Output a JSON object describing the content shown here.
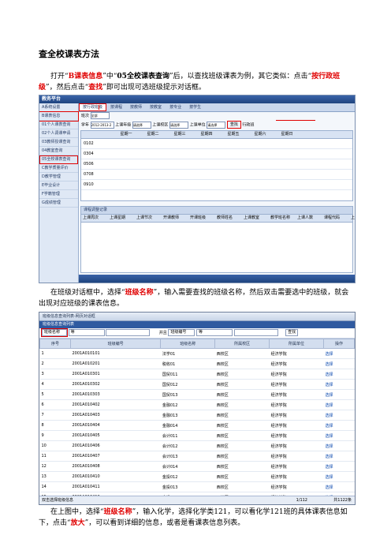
{
  "title": "查全校课表方法",
  "para1": {
    "t1": "打开“",
    "r1": "B课表信息",
    "t2": "”中“",
    "b1": "05全校课表查询",
    "t3": "”后，以查找班级课表为例，其它类似：点击“",
    "r2": "按行政班级",
    "t4": "”，然后点击“",
    "r3": "查找",
    "t5": "”即可出现可选班级提示对话框。"
  },
  "shot1": {
    "top_title": "教务平台",
    "side_items": [
      "A系统设置",
      "B课表信息",
      "01个人课表查询",
      "02个人调课申请",
      "03教师授课查询",
      "04教室查询",
      "05全校课表查询",
      "C教学质量评价",
      "D教学管理",
      "E毕业设计",
      "F学籍管理",
      "G成绩管理"
    ],
    "tabs": [
      "按行政班级",
      "按课程",
      "按教师",
      "按教室",
      "按专业",
      "按学生"
    ],
    "row1": "班次",
    "row1_sel": "全部",
    "row2": "学年",
    "row2_val": "2012-2013-2",
    "row2_f1": "上课年级",
    "row2_f2": "上课校区",
    "row2_f3": "上课单位",
    "select_ph": "请选择",
    "find_btn": "查找",
    "class_label": "行政班",
    "grid_headers": [
      "星期一",
      "星期二",
      "星期三",
      "星期四",
      "星期五",
      "星期六",
      "星期日"
    ],
    "grid_rows": [
      "0102",
      "0304",
      "0506",
      "0708",
      "0910"
    ],
    "lower_title": "课程调整记录",
    "lower_headers": [
      "上课周次",
      "上课星期",
      "上课节次",
      "开课教师",
      "开课班级",
      "教师姓名",
      "上课教室",
      "教学班名称",
      "上课人数",
      "课程代码",
      "上课周",
      "备注"
    ]
  },
  "para2": {
    "t1": "在班级对话框中，选择“",
    "r1": "班级名称",
    "t2": "”，输入需要查找的班级名称，然后双击需要选中的班级，就会出现对应班级的课表信息。"
  },
  "shot2": {
    "title": "班级信息查询列表-网页对话框",
    "sub": "班级信息查询列表",
    "f1_val": "班级名称",
    "op1": "等",
    "and_label": "并且",
    "f2_val": "班级编号",
    "op2": "等",
    "find_btn": "查找",
    "headers": [
      "序号",
      "班级编号",
      "班级名称",
      "所属校区",
      "所属单位",
      "操作"
    ],
    "rows": [
      [
        "1",
        "2001A010101",
        "法学01",
        "西校区",
        "经济学院",
        "选择"
      ],
      [
        "2",
        "2001A010201",
        "税收01",
        "西校区",
        "经济学院",
        "选择"
      ],
      [
        "3",
        "2001A010301",
        "国贸011",
        "西校区",
        "经济学院",
        "选择"
      ],
      [
        "4",
        "2001A010302",
        "国贸012",
        "西校区",
        "经济学院",
        "选择"
      ],
      [
        "5",
        "2001A010303",
        "国贸013",
        "西校区",
        "经济学院",
        "选择"
      ],
      [
        "6",
        "2001A010402",
        "金融012",
        "西校区",
        "经济学院",
        "选择"
      ],
      [
        "7",
        "2001A010403",
        "金融013",
        "西校区",
        "经济学院",
        "选择"
      ],
      [
        "8",
        "2001A010404",
        "金融014",
        "西校区",
        "经济学院",
        "选择"
      ],
      [
        "9",
        "2001A010405",
        "会计011",
        "西校区",
        "经济学院",
        "选择"
      ],
      [
        "10",
        "2001A010406",
        "会计012",
        "西校区",
        "经济学院",
        "选择"
      ],
      [
        "11",
        "2001A010407",
        "会计013",
        "西校区",
        "经济学院",
        "选择"
      ],
      [
        "12",
        "2001A010408",
        "会计014",
        "西校区",
        "经济学院",
        "选择"
      ],
      [
        "13",
        "2001A010410",
        "金投012",
        "西校区",
        "经济学院",
        "选择"
      ],
      [
        "14",
        "2001A010411",
        "金投013",
        "西校区",
        "经济学院",
        "选择"
      ],
      [
        "15",
        "2001A010412",
        "金投014",
        "西校区",
        "经济学院",
        "选择"
      ],
      [
        "16",
        "2001A010601",
        "财政01",
        "西校区",
        "经济学院",
        "选择"
      ],
      [
        "17",
        "2001A010801",
        "财务01",
        "西校区",
        "经济学院",
        "选择"
      ]
    ],
    "footer_left": "双击选择班级信息",
    "footer_page": "1/112",
    "footer_total": "共1122条"
  },
  "para3": {
    "t1": "在上图中，选择“",
    "r1": "班级名称",
    "t2": "”，输入化学，选择化学类121，可以看化学121班的具体课表信息如下，点击“",
    "r2": "放大",
    "t3": "”，可以看到详细的信息，或者是看课表信息列表。"
  }
}
